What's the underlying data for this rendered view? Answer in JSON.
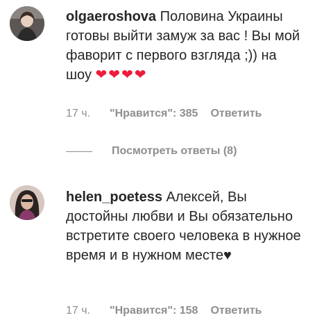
{
  "comments": [
    {
      "username": "olgaeroshova",
      "text": "Половина Украины готовы выйти замуж за вас ! Вы мой фаворит с первого взгляда ;)) на шоу",
      "emoji": "❤❤❤❤",
      "time": "17 ч.",
      "likes": "\"Нравится\": 385",
      "reply_label": "Ответить",
      "view_replies": "Посмотреть ответы (8)"
    },
    {
      "username": "helen_poetess",
      "text": "Алексей, Вы достойны любви и Вы обязательно встретите своего человека в нужное время и в нужном месте♥",
      "time": "17 ч.",
      "likes": "\"Нравится\": 158",
      "reply_label": "Ответить"
    }
  ]
}
